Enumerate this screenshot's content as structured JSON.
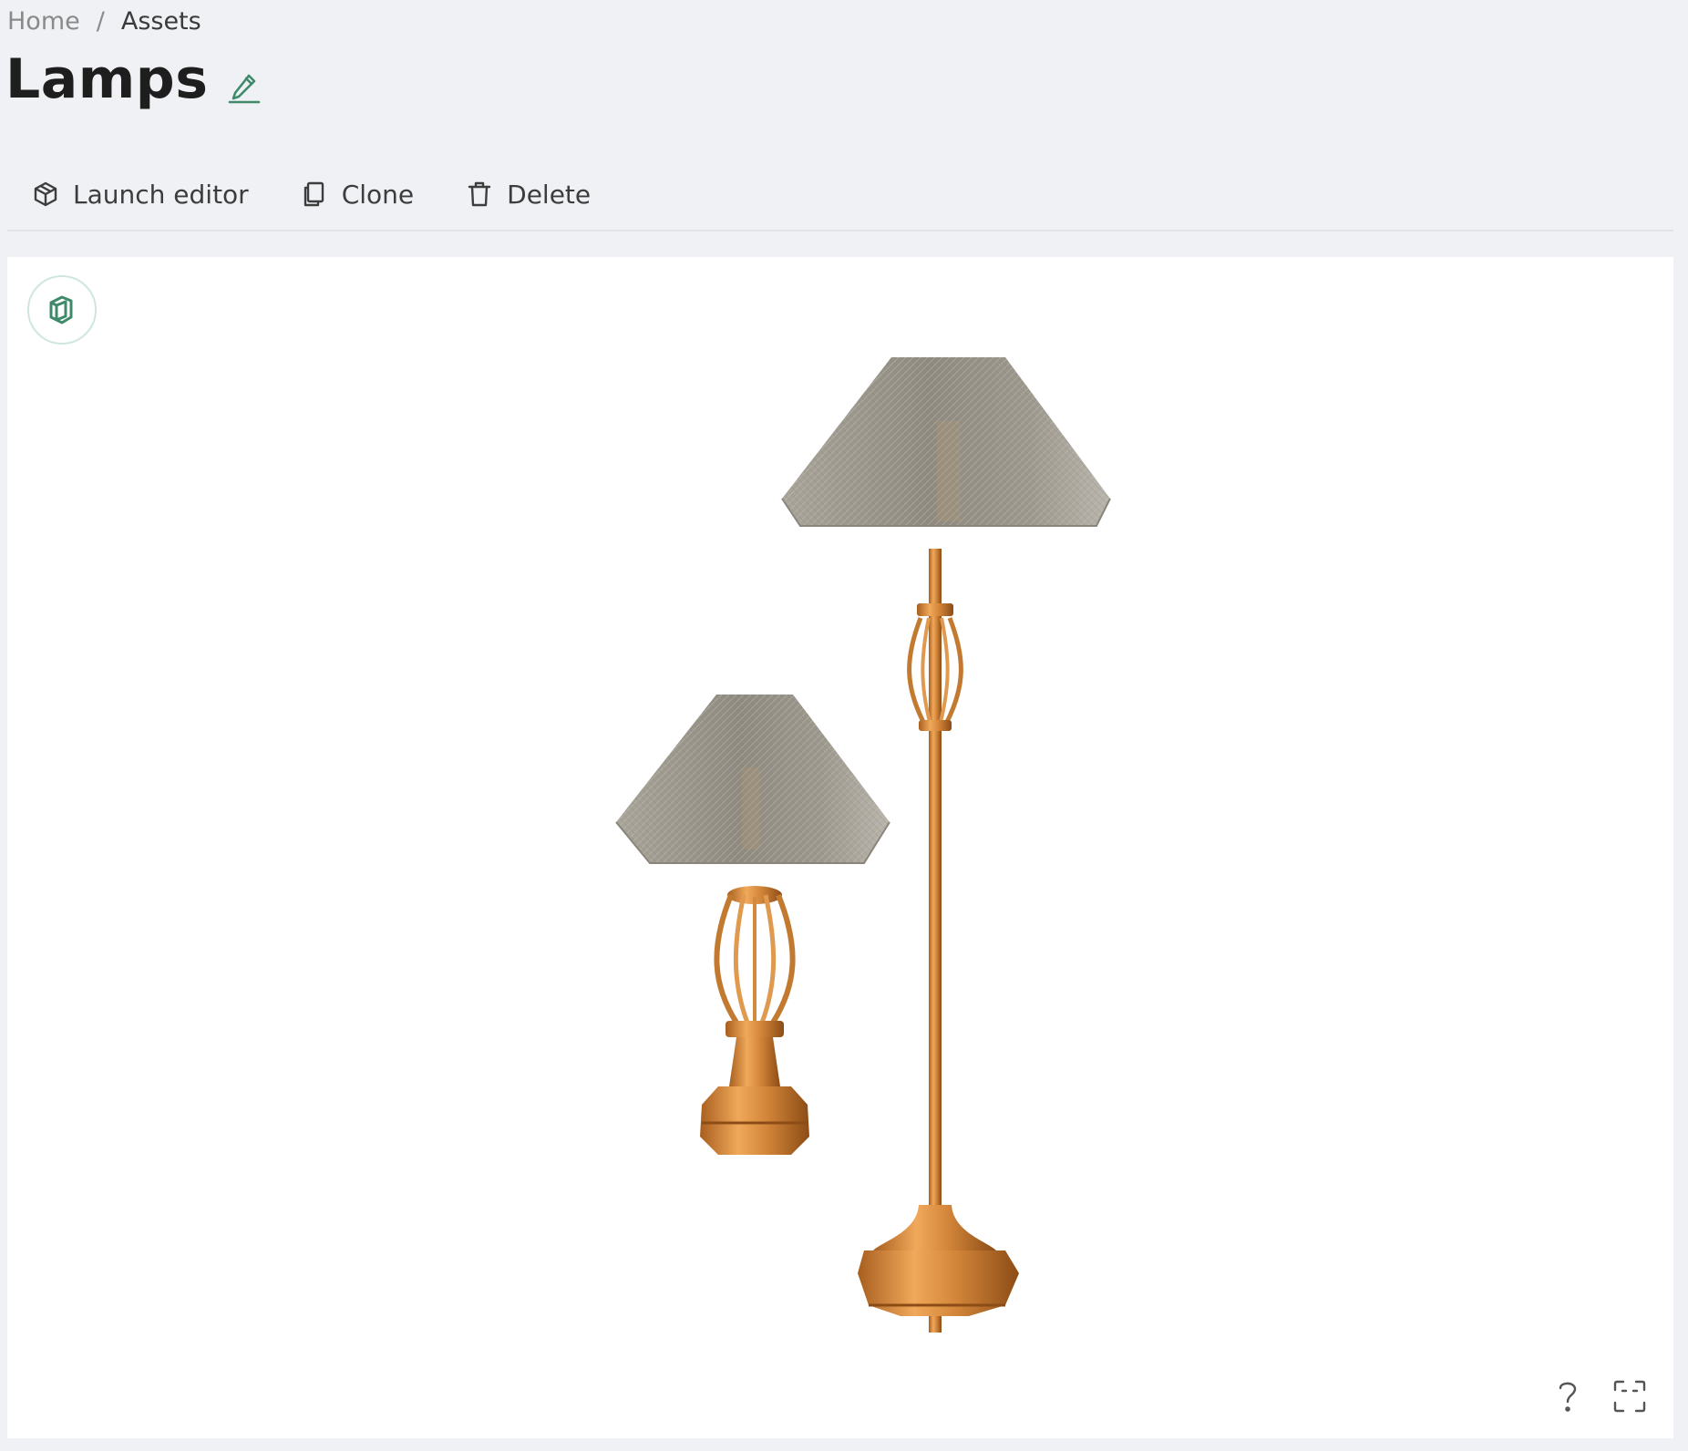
{
  "breadcrumb": {
    "home": "Home",
    "separator": "/",
    "current": "Assets"
  },
  "page": {
    "title": "Lamps"
  },
  "toolbar": {
    "launch_editor_label": "Launch editor",
    "clone_label": "Clone",
    "delete_label": "Delete"
  },
  "icons": {
    "edit": "pencil-icon",
    "launch_editor": "cube-icon",
    "clone": "copy-icon",
    "delete": "trash-icon",
    "viewer_badge": "layers-icon",
    "help": "question-icon",
    "fullscreen": "fullscreen-icon"
  },
  "colors": {
    "accent": "#3f8a6b",
    "background": "#f0f1f4",
    "viewer_background": "#ffffff",
    "lamp_metal": "#c98236",
    "lamp_shade": "#9c978c"
  }
}
